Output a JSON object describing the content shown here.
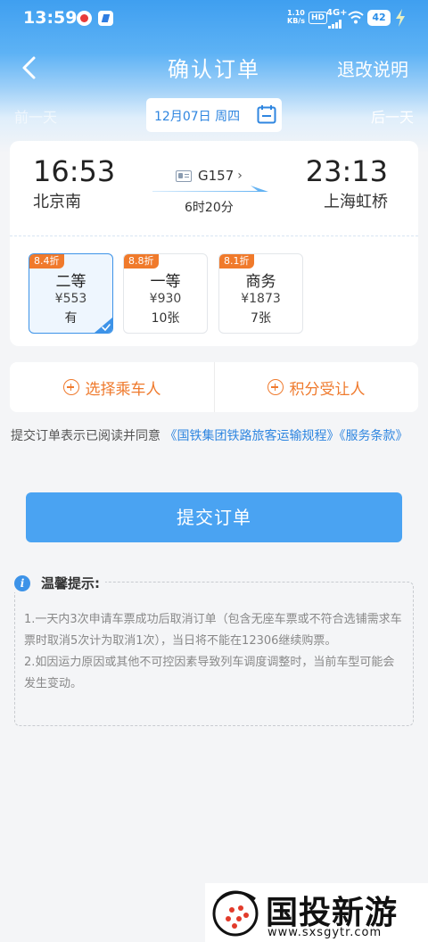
{
  "status_bar": {
    "time": "13:59",
    "net_speed": "1.10",
    "net_unit": "KB/s",
    "hd": "HD",
    "network": "4G+",
    "battery": "42"
  },
  "nav": {
    "title": "确认订单",
    "right_action": "退改说明"
  },
  "date_bar": {
    "prev_day": "前一天",
    "date": "12月07日 周四",
    "next_day": "后一天"
  },
  "train": {
    "depart_time": "16:53",
    "depart_station": "北京南",
    "number": "G157",
    "duration": "6时20分",
    "arrive_time": "23:13",
    "arrive_station": "上海虹桥"
  },
  "seats": [
    {
      "badge": "8.4折",
      "name": "二等",
      "price": "¥553",
      "availability": "有",
      "selected": true
    },
    {
      "badge": "8.8折",
      "name": "一等",
      "price": "¥930",
      "availability": "10张",
      "selected": false
    },
    {
      "badge": "8.1折",
      "name": "商务",
      "price": "¥1873",
      "availability": "7张",
      "selected": false
    }
  ],
  "actions": {
    "choose_passenger": "选择乘车人",
    "points_recipient": "积分受让人"
  },
  "agreement": {
    "prefix": "提交订单表示已阅读并同意",
    "rules_link": "《国铁集团铁路旅客运输规程》",
    "terms_link": "《服务条款》"
  },
  "submit_label": "提交订单",
  "tips": {
    "title": "温馨提示:",
    "item1": "1.一天内3次申请车票成功后取消订单（包含无座车票或不符合选铺需求车票时取消5次计为取消1次），当日将不能在12306继续购票。",
    "item2": "2.如因运力原因或其他不可控因素导致列车调度调整时，当前车型可能会发生变动。"
  },
  "watermark": {
    "name": "国投新游网",
    "url": "www.sxsgytr.com"
  },
  "colors": {
    "brand_blue": "#3d93e8",
    "accent_orange": "#ef7a2d",
    "submit_button": "#4aa3f2"
  }
}
